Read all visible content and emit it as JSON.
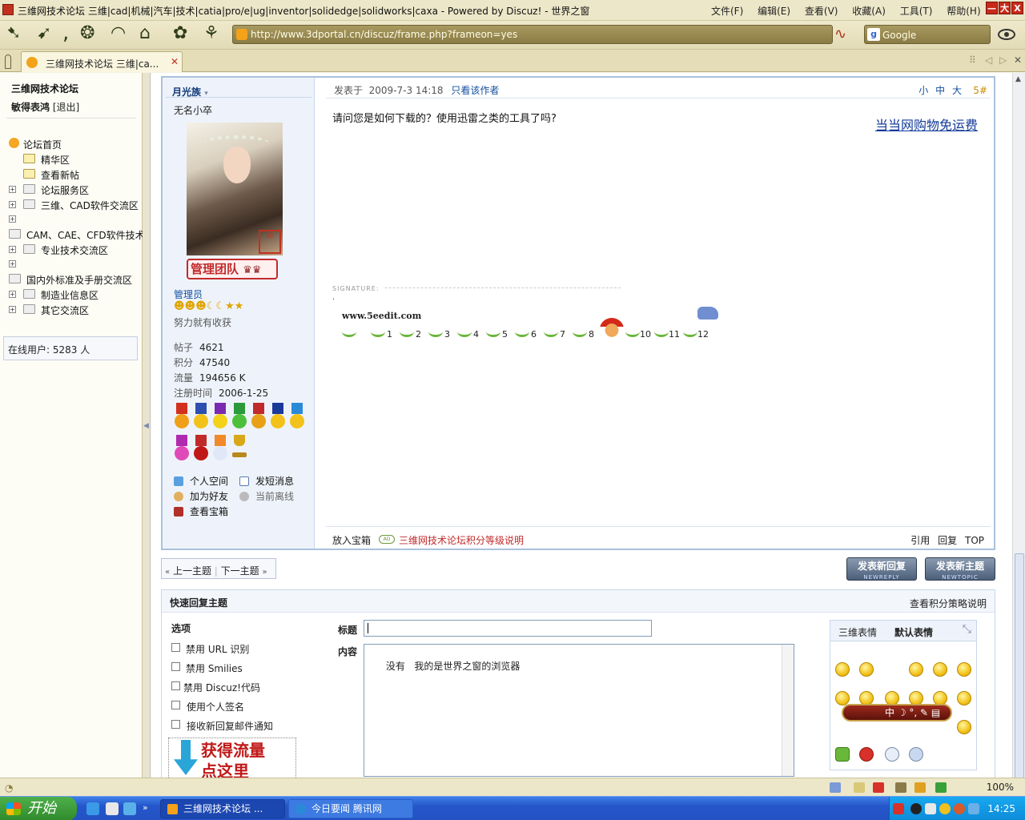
{
  "window": {
    "title": "三维网技术论坛 三维|cad|机械|汽车|技术|catia|pro/e|ug|inventor|solidedge|solidworks|caxa - Powered by Discuz! - 世界之窗",
    "menu": [
      "文件(F)",
      "编辑(E)",
      "查看(V)",
      "收藏(A)",
      "工具(T)",
      "帮助(H)"
    ],
    "controls": [
      "—",
      "大",
      "X"
    ]
  },
  "toolbar": {
    "address": "http://www.3dportal.cn/discuz/frame.php?frameon=yes",
    "search_engine": "Google",
    "icons": [
      "back-icon",
      "forward-icon",
      "refresh-icon",
      "home-icon",
      "stop-icon",
      "favorites-icon",
      "history-icon",
      "bamboo-icon"
    ]
  },
  "tabs": [
    {
      "label": "三维网技术论坛 三维|ca..."
    }
  ],
  "sidebar": {
    "site_name": "三维网技术论坛",
    "username": "敏得表鸿",
    "logout": "[退出]",
    "tree": [
      {
        "label": "论坛首页"
      },
      {
        "label": "精华区"
      },
      {
        "label": "查看新帖"
      },
      {
        "label": "论坛服务区"
      },
      {
        "label": "三维、CAD软件交流区"
      },
      {
        "label": "CAM、CAE、CFD软件技术"
      },
      {
        "label": "专业技术交流区"
      },
      {
        "label": "国内外标准及手册交流区"
      },
      {
        "label": "制造业信息区"
      },
      {
        "label": "其它交流区"
      }
    ],
    "online_users": "在线用户: 5283 人"
  },
  "post": {
    "author": {
      "name": "月光族",
      "title": "无名小卒",
      "badge": "管理团队",
      "role": "管理员",
      "motto": "努力就有收获",
      "stats": [
        {
          "label": "帖子",
          "value": "4621"
        },
        {
          "label": "积分",
          "value": "47540"
        },
        {
          "label": "流量",
          "value": "194656 K"
        },
        {
          "label": "注册时间",
          "value": "2006-1-25"
        }
      ],
      "links": [
        "个人空间",
        "发短消息",
        "加为好友",
        "当前离线",
        "查看宝箱"
      ]
    },
    "meta": {
      "posted_label": "发表于",
      "posted_time": "2009-7-3 14:18",
      "only_author": "只看该作者",
      "sizes": [
        "小",
        "中",
        "大"
      ],
      "floor": "5#"
    },
    "body": "请问您是如何下载的？使用迅雷之类的工具了吗?",
    "ad_link": "当当网购物免运费",
    "signature_label": "SIGNATURE:",
    "signature_dot": ".",
    "signature_site": "www.5eedit.com",
    "signature_numbers": [
      "1",
      "2",
      "3",
      "4",
      "5",
      "6",
      "7",
      "8",
      "10",
      "11",
      "12"
    ],
    "footer": {
      "to_box": "放入宝箱",
      "ad_tag": "AD",
      "points_link": "三维网技术论坛积分等级说明",
      "actions": [
        "引用",
        "回复",
        "TOP"
      ]
    }
  },
  "thread_nav": {
    "prev": "上一主题",
    "next": "下一主题"
  },
  "buttons": {
    "new_reply": "发表新回复",
    "new_reply_sub": "NEWREPLY",
    "new_topic": "发表新主题",
    "new_topic_sub": "NEWTOPIC"
  },
  "quick_reply": {
    "title": "快速回复主题",
    "policy_link": "查看积分策略说明",
    "options_title": "选项",
    "options": [
      "禁用 URL 识别",
      "禁用 Smilies",
      "禁用 Discuz!代码",
      "使用个人签名",
      "接收新回复邮件通知"
    ],
    "promo_line1": "获得流量",
    "promo_line2": "点这里",
    "subject_label": "标题",
    "subject_value": "",
    "content_label": "内容",
    "content_value": "没有   我的是世界之窗的浏览器",
    "smiley_tabs": [
      "三维表情",
      "默认表情"
    ],
    "im_bar_text": "中"
  },
  "statusbar": {
    "zoom": "100%"
  },
  "taskbar": {
    "start": "开始",
    "tasks": [
      {
        "label": "三维网技术论坛 ..."
      },
      {
        "label": "今日要闻 腾讯网"
      }
    ],
    "clock": "14:25"
  }
}
